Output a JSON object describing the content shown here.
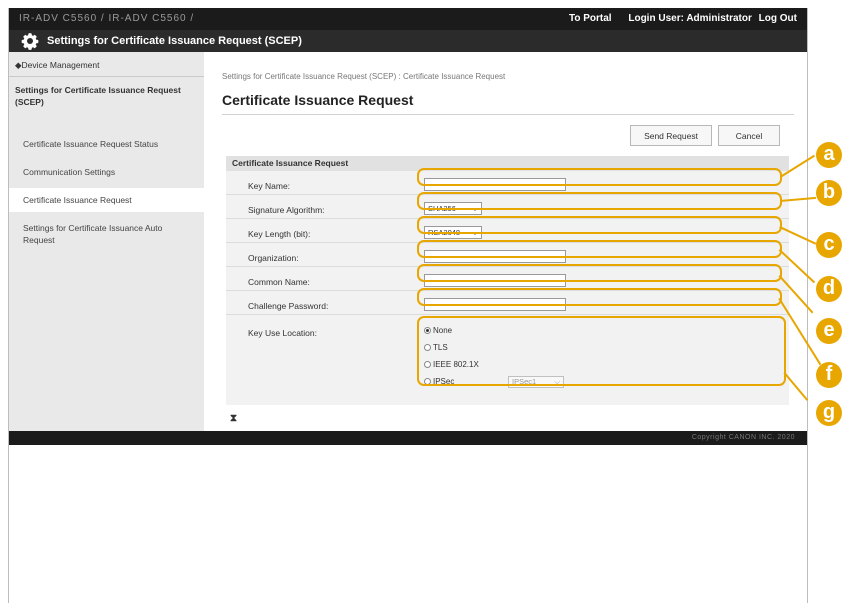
{
  "topbar": {
    "device_name": "IR-ADV C5560 / IR-ADV C5560 /",
    "portal_link": "To Portal",
    "login_user": "Login User: Administrator",
    "logout": "Log Out"
  },
  "titlebar": {
    "title": "Settings for Certificate Issuance Request (SCEP)",
    "icon": "gear-icon"
  },
  "sidebar": {
    "back_link": "◆Device Management",
    "heading": "Settings for Certificate Issuance Request (SCEP)",
    "items": [
      {
        "label": "Certificate Issuance Request Status"
      },
      {
        "label": "Communication Settings"
      },
      {
        "label": "Certificate Issuance Request"
      },
      {
        "label": "Settings for Certificate Issuance Auto Request"
      }
    ]
  },
  "main": {
    "breadcrumb": "Settings for Certificate Issuance Request (SCEP) : Certificate Issuance Request",
    "title": "Certificate Issuance Request",
    "send_label": "Send Request",
    "cancel_label": "Cancel",
    "form_header": "Certificate Issuance Request",
    "fields": {
      "key_name": {
        "label": "Key Name:",
        "value": ""
      },
      "signature_algorithm": {
        "label": "Signature Algorithm:",
        "value": "SHA256"
      },
      "key_length": {
        "label": "Key Length (bit):",
        "value": "RSA2048"
      },
      "organization": {
        "label": "Organization:",
        "value": ""
      },
      "common_name": {
        "label": "Common Name:",
        "value": ""
      },
      "challenge_password": {
        "label": "Challenge Password:",
        "value": ""
      },
      "key_use_location": {
        "label": "Key Use Location:",
        "options": [
          "None",
          "TLS",
          "IEEE 802.1X",
          "IPSec"
        ],
        "selected": "None",
        "ipsec_policy": "IPSec1"
      }
    },
    "top_icon": "⧗"
  },
  "footer": {
    "copyright": "Copyright CANON INC. 2020"
  },
  "callouts": {
    "color": "#e8a600",
    "labels": [
      "a",
      "b",
      "c",
      "d",
      "e",
      "f",
      "g"
    ]
  }
}
